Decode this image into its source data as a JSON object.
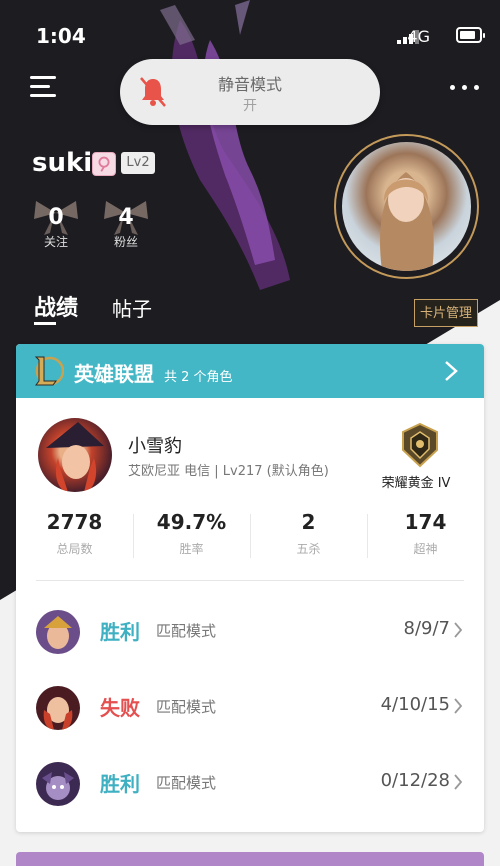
{
  "status_bar": {
    "time": "1:04",
    "network": "4G"
  },
  "toast": {
    "title": "静音模式",
    "state": "开"
  },
  "profile": {
    "username": "suki",
    "level": "Lv2",
    "following": {
      "count": "0",
      "label": "关注"
    },
    "fans": {
      "count": "4",
      "label": "粉丝"
    }
  },
  "tabs": [
    {
      "label": "战绩"
    },
    {
      "label": "帖子"
    }
  ],
  "card_manage_label": "卡片管理",
  "game_card": {
    "title": "英雄联盟",
    "subtitle": "共 2 个角色",
    "champion_name": "小雪豹",
    "champion_sub": "艾欧尼亚 电信 | Lv217 (默认角色)",
    "rank": "荣耀黄金 IV",
    "stats": [
      {
        "value": "2778",
        "label": "总局数"
      },
      {
        "value": "49.7%",
        "label": "胜率"
      },
      {
        "value": "2",
        "label": "五杀"
      },
      {
        "value": "174",
        "label": "超神"
      }
    ],
    "matches": [
      {
        "result": "胜利",
        "mode": "匹配模式",
        "kda": "8/9/7"
      },
      {
        "result": "失败",
        "mode": "匹配模式",
        "kda": "4/10/15"
      },
      {
        "result": "胜利",
        "mode": "匹配模式",
        "kda": "0/12/28"
      }
    ]
  },
  "colors": {
    "accent": "#43b7c6",
    "win": "#3fb0c2",
    "lose": "#e44f4f",
    "gold": "#c49a5a"
  }
}
